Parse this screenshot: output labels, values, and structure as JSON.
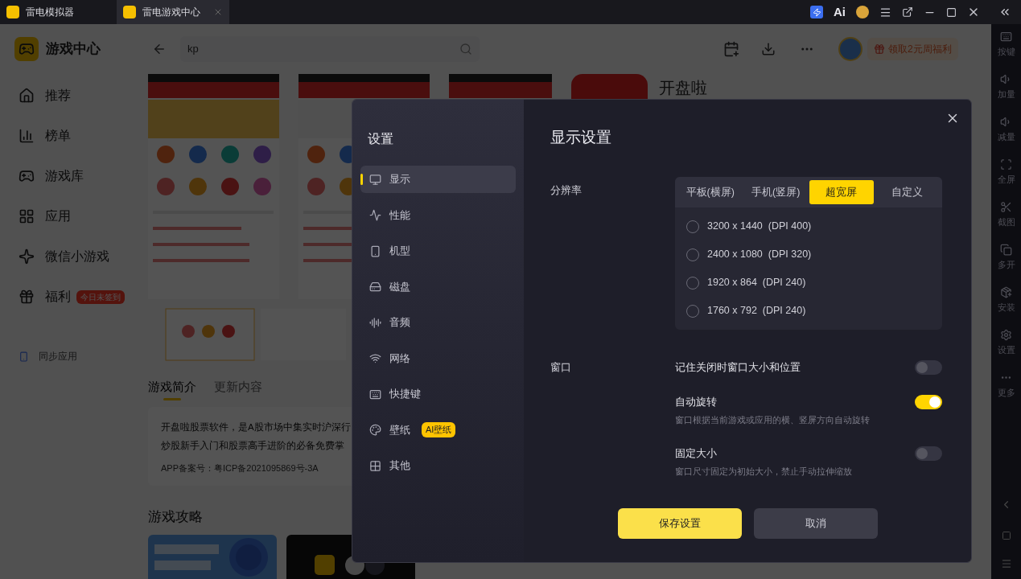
{
  "titlebar": {
    "ai_label": "Ai",
    "tabs": [
      {
        "label": "雷电模拟器",
        "selected": false
      },
      {
        "label": "雷电游戏中心",
        "selected": true
      }
    ]
  },
  "header": {
    "title": "游戏中心",
    "search": {
      "value": "kp"
    },
    "promo": "领取2元周福利"
  },
  "sidebar": {
    "items": [
      {
        "label": "推荐"
      },
      {
        "label": "榜单"
      },
      {
        "label": "游戏库"
      },
      {
        "label": "应用"
      },
      {
        "label": "微信小游戏"
      },
      {
        "label": "福利",
        "badge": "今日未签到"
      }
    ],
    "sync": "同步应用"
  },
  "detail": {
    "app_name": "开盘啦",
    "tabs": [
      {
        "label": "游戏简介",
        "selected": true
      },
      {
        "label": "更新内容",
        "selected": false
      }
    ],
    "description": [
      "开盘啦股票软件，是A股市场中集实时沪深行",
      "炒股新手入门和股票高手进阶的必备免费掌"
    ],
    "filing": "APP备案号：粤ICP备2021095869号-3A",
    "guides_title": "游戏攻略"
  },
  "toolbar": {
    "items": [
      "按键",
      "加量",
      "减量",
      "全屏",
      "截图",
      "多开",
      "安装",
      "设置",
      "更多"
    ]
  },
  "settings": {
    "title": "设置",
    "nav": [
      {
        "label": "显示",
        "selected": true
      },
      {
        "label": "性能",
        "selected": false
      },
      {
        "label": "机型",
        "selected": false
      },
      {
        "label": "磁盘",
        "selected": false
      },
      {
        "label": "音频",
        "selected": false
      },
      {
        "label": "网络",
        "selected": false
      },
      {
        "label": "快捷键",
        "selected": false
      },
      {
        "label": "壁纸",
        "selected": false,
        "badge": "AI壁纸"
      },
      {
        "label": "其他",
        "selected": false
      }
    ],
    "heading": "显示设置",
    "resolution": {
      "label": "分辨率",
      "tabs": [
        {
          "label": "平板(横屏)",
          "selected": false
        },
        {
          "label": "手机(竖屏)",
          "selected": false
        },
        {
          "label": "超宽屏",
          "selected": true
        },
        {
          "label": "自定义",
          "selected": false
        }
      ],
      "options": [
        {
          "label": "3200 x 1440  (DPI 400)",
          "selected": false
        },
        {
          "label": "2400 x 1080  (DPI 320)",
          "selected": false
        },
        {
          "label": "1920 x 864  (DPI 240)",
          "selected": false
        },
        {
          "label": "1760 x 792  (DPI 240)",
          "selected": false
        }
      ]
    },
    "window": {
      "label": "窗口",
      "toggles": [
        {
          "label": "记住关闭时窗口大小和位置",
          "on": false
        },
        {
          "label": "自动旋转",
          "description": "窗口根据当前游戏或应用的横、竖屏方向自动旋转",
          "on": true
        },
        {
          "label": "固定大小",
          "description": "窗口尺寸固定为初始大小，禁止手动拉伸缩放",
          "on": false
        }
      ]
    },
    "buttons": [
      {
        "label": "保存设置",
        "kind": "primary"
      },
      {
        "label": "取消",
        "kind": "secondary"
      }
    ]
  }
}
